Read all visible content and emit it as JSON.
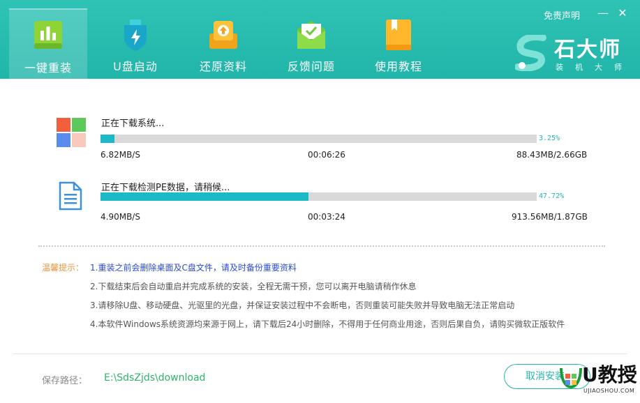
{
  "header": {
    "tabs": [
      {
        "label": "一键重装",
        "icon": "chart-bars-icon",
        "active": true
      },
      {
        "label": "U盘启动",
        "icon": "usb-shield-icon",
        "active": false
      },
      {
        "label": "还原资料",
        "icon": "restore-box-icon",
        "active": false
      },
      {
        "label": "反馈问题",
        "icon": "envelope-icon",
        "active": false
      },
      {
        "label": "使用教程",
        "icon": "book-icon",
        "active": false
      }
    ],
    "disclaimer": "免责声明",
    "logo_title": "石大师",
    "logo_subtitle": "装机大师"
  },
  "downloads": [
    {
      "title": "正在下载系统...",
      "icon": "windows-logo-icon",
      "percent": 3.25,
      "percent_text": "3.25%",
      "speed": "6.82MB/S",
      "time": "00:06:26",
      "size": "88.43MB/2.66GB"
    },
    {
      "title": "正在下载检测PE数据，请稍候...",
      "icon": "document-icon",
      "percent": 47.72,
      "percent_text": "47.72%",
      "speed": "4.90MB/S",
      "time": "00:03:24",
      "size": "913.56MB/1.87GB"
    }
  ],
  "tips": {
    "label": "温馨提示：",
    "items": [
      "1.重装之前会删除桌面及C盘文件，请及时备份重要资料",
      "2.下载结束后会自动重启并完成系统的安装，全程无需干预，您可以离开电脑请稍作休息",
      "3.请移除U盘、移动硬盘、光驱里的光盘，并保证安装过程中不会断电，否则重装可能失败并导致电脑无法正常启动",
      "4.本软件Windows系统资源均来源于网上，请下载后24小时删除，不得用于任何商业用途，否则后果自负，请购买微软正版软件"
    ]
  },
  "footer": {
    "path_label": "保存路径：",
    "path_value": "E:\\SdsZjds\\download",
    "cancel_label": "取消安装",
    "watermark": "U教授",
    "watermark_sub": "UJIAOSHOU.COM"
  },
  "colors": {
    "accent": "#22b5aa",
    "progress": "#1cbac6",
    "tip_highlight": "#2a4bd6",
    "tip_label": "#e9963c",
    "path": "#2bb36a"
  }
}
